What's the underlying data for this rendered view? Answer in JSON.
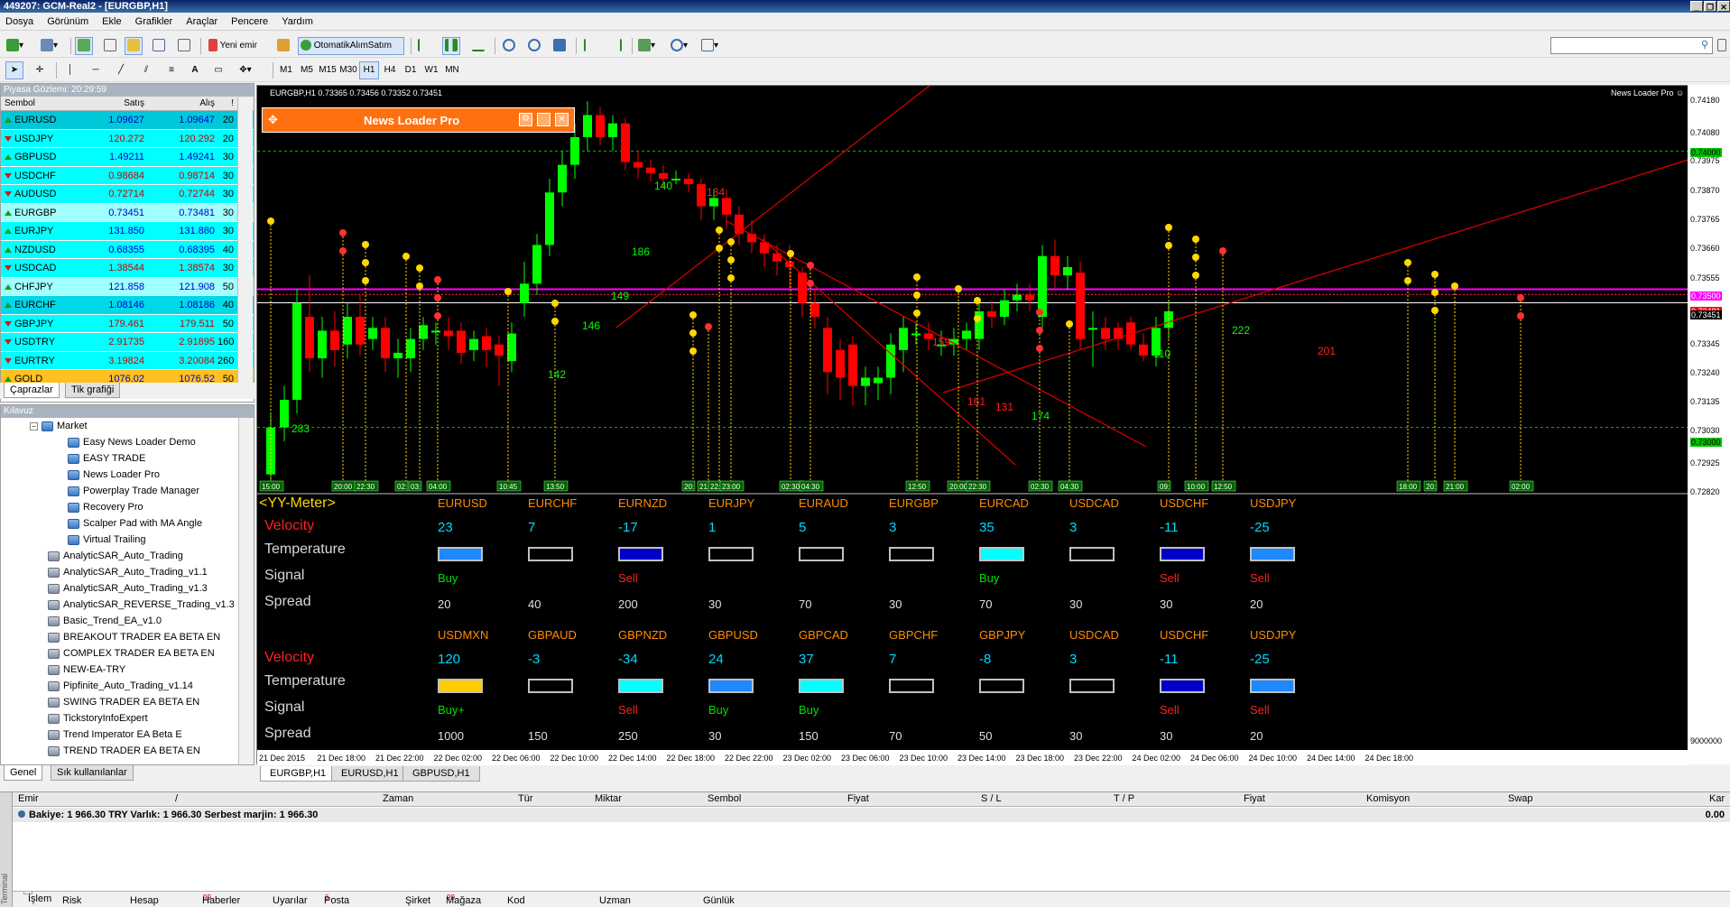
{
  "window": {
    "title": "449207: GCM-Real2 - [EURGBP,H1]",
    "min": "_",
    "restore": "❐",
    "close": "✕"
  },
  "menu": [
    "Dosya",
    "Görünüm",
    "Ekle",
    "Grafikler",
    "Araçlar",
    "Pencere",
    "Yardım"
  ],
  "toolbar": {
    "new_order": "Yeni emir",
    "autotrade": "OtomatikAlımSatım",
    "search_placeholder": ""
  },
  "timeframes": [
    "M1",
    "M5",
    "M15",
    "M30",
    "H1",
    "H4",
    "D1",
    "W1",
    "MN"
  ],
  "active_timeframe": "H1",
  "market_watch": {
    "title": "Piyasa Gözlemi: 20:29:59",
    "headers": [
      "Sembol",
      "Satış",
      "Alış",
      "!"
    ],
    "rows": [
      {
        "sym": "EURUSD",
        "bid": "1.09627",
        "ask": "1.09647",
        "spread": "20",
        "dir": "up",
        "bg": "#00c8d8"
      },
      {
        "sym": "USDJPY",
        "bid": "120.272",
        "ask": "120.292",
        "spread": "20",
        "dir": "dn",
        "bg": "#00ffff"
      },
      {
        "sym": "GBPUSD",
        "bid": "1.49211",
        "ask": "1.49241",
        "spread": "30",
        "dir": "up",
        "bg": "#00ffff"
      },
      {
        "sym": "USDCHF",
        "bid": "0.98684",
        "ask": "0.98714",
        "spread": "30",
        "dir": "dn",
        "bg": "#00ffff"
      },
      {
        "sym": "AUDUSD",
        "bid": "0.72714",
        "ask": "0.72744",
        "spread": "30",
        "dir": "dn",
        "bg": "#00ffff"
      },
      {
        "sym": "EURGBP",
        "bid": "0.73451",
        "ask": "0.73481",
        "spread": "30",
        "dir": "up",
        "bg": "#a0ffff"
      },
      {
        "sym": "EURJPY",
        "bid": "131.850",
        "ask": "131.880",
        "spread": "30",
        "dir": "up",
        "bg": "#00ffff"
      },
      {
        "sym": "NZDUSD",
        "bid": "0.68355",
        "ask": "0.68395",
        "spread": "40",
        "dir": "up",
        "bg": "#00ffff"
      },
      {
        "sym": "USDCAD",
        "bid": "1.38544",
        "ask": "1.38574",
        "spread": "30",
        "dir": "dn",
        "bg": "#00ffff"
      },
      {
        "sym": "CHFJPY",
        "bid": "121.858",
        "ask": "121.908",
        "spread": "50",
        "dir": "up",
        "bg": "#a0ffff"
      },
      {
        "sym": "EURCHF",
        "bid": "1.08146",
        "ask": "1.08186",
        "spread": "40",
        "dir": "up",
        "bg": "#00d8e8"
      },
      {
        "sym": "GBPJPY",
        "bid": "179.461",
        "ask": "179.511",
        "spread": "50",
        "dir": "dn",
        "bg": "#00ffff"
      },
      {
        "sym": "USDTRY",
        "bid": "2.91735",
        "ask": "2.91895",
        "spread": "160",
        "dir": "dn",
        "bg": "#00ffff"
      },
      {
        "sym": "EURTRY",
        "bid": "3.19824",
        "ask": "3.20084",
        "spread": "260",
        "dir": "dn",
        "bg": "#00ffff"
      },
      {
        "sym": "GOLD",
        "bid": "1076.02",
        "ask": "1076.52",
        "spread": "50",
        "dir": "up",
        "bg": "#ffc020"
      }
    ],
    "tabs": [
      "Çaprazlar",
      "Tik grafiği"
    ]
  },
  "navigator": {
    "title": "Kılavuz",
    "folder": "Market",
    "market_items": [
      "Easy News Loader Demo",
      "EASY TRADE",
      "News Loader Pro",
      "Powerplay Trade Manager",
      "Recovery Pro",
      "Scalper Pad with MA Angle",
      "Virtual Trailing"
    ],
    "experts": [
      "AnalyticSAR_Auto_Trading",
      "AnalyticSAR_Auto_Trading_v1.1",
      "AnalyticSAR_Auto_Trading_v1.3",
      "AnalyticSAR_REVERSE_Trading_v1.3",
      "Basic_Trend_EA_v1.0",
      "BREAKOUT TRADER EA BETA EN",
      "COMPLEX TRADER EA BETA EN",
      "NEW-EA-TRY",
      "Pipfinite_Auto_Trading_v1.14",
      "SWING TRADER EA BETA EN",
      "TickstoryInfoExpert",
      "Trend Imperator EA Beta E",
      "TREND TRADER EA BETA EN"
    ],
    "tabs": [
      "Genel",
      "Sık kullanılanlar"
    ]
  },
  "chart": {
    "header": "EURGBP,H1  0.73365 0.73456 0.73352 0.73451",
    "ea_label": "News Loader Pro ☺",
    "panel_title": "News Loader Pro",
    "meter_title": "<YY-Meter>",
    "price_labels": [
      "0.74180",
      "0.74080",
      "0.74000",
      "0.73975",
      "0.73870",
      "0.73765",
      "0.73660",
      "0.73555",
      "0.73500",
      "0.73481",
      "0.73451",
      "0.73345",
      "0.73240",
      "0.73135",
      "0.73030",
      "0.73000",
      "0.72925",
      "0.72820"
    ],
    "sub_label": "9000000",
    "time_labels": [
      "21 Dec 2015",
      "21 Dec 18:00",
      "21 Dec 22:00",
      "22 Dec 02:00",
      "22 Dec 06:00",
      "22 Dec 10:00",
      "22 Dec 14:00",
      "22 Dec 18:00",
      "22 Dec 22:00",
      "23 Dec 02:00",
      "23 Dec 06:00",
      "23 Dec 10:00",
      "23 Dec 14:00",
      "23 Dec 18:00",
      "23 Dec 22:00",
      "24 Dec 02:00",
      "24 Dec 06:00",
      "24 Dec 10:00",
      "24 Dec 14:00",
      "24 Dec 18:00"
    ],
    "event_times": [
      "15:00",
      "20:00",
      "22:30",
      "02:",
      "03:",
      "04:00",
      "10:45",
      "13:50",
      "20:",
      "21:",
      "22:",
      "23:00",
      "02:30",
      "04:30",
      "12:50",
      "20:00",
      "22:30",
      "02:30",
      "04:30",
      "09:",
      "10:00",
      "12:50",
      "18:00",
      "20:",
      "21:00",
      "02:00"
    ],
    "pip_labels": [
      {
        "t": "283",
        "c": "green"
      },
      {
        "t": "142",
        "c": "green"
      },
      {
        "t": "146",
        "c": "green"
      },
      {
        "t": "149",
        "c": "green"
      },
      {
        "t": "186",
        "c": "green"
      },
      {
        "t": "140",
        "c": "green"
      },
      {
        "t": "134",
        "c": "red"
      },
      {
        "t": "159",
        "c": "red"
      },
      {
        "t": "161",
        "c": "red"
      },
      {
        "t": "131",
        "c": "red"
      },
      {
        "t": "174",
        "c": "green"
      },
      {
        "t": "110",
        "c": "green"
      },
      {
        "t": "222",
        "c": "green"
      },
      {
        "t": "201",
        "c": "red"
      }
    ]
  },
  "meter": {
    "row_labels": [
      "Velocity",
      "Temperature",
      "Signal",
      "Spread"
    ],
    "block1": [
      {
        "pair": "EURUSD",
        "vel": "23",
        "temp": "#1e88ff",
        "sig": "Buy",
        "spread": "20"
      },
      {
        "pair": "EURCHF",
        "vel": "7",
        "temp": "#000000",
        "sig": "",
        "spread": "40"
      },
      {
        "pair": "EURNZD",
        "vel": "-17",
        "temp": "#0000c8",
        "sig": "Sell",
        "spread": "200"
      },
      {
        "pair": "EURJPY",
        "vel": "1",
        "temp": "#000000",
        "sig": "",
        "spread": "30"
      },
      {
        "pair": "EURAUD",
        "vel": "5",
        "temp": "#000000",
        "sig": "",
        "spread": "70"
      },
      {
        "pair": "EURGBP",
        "vel": "3",
        "temp": "#000000",
        "sig": "",
        "spread": "30"
      },
      {
        "pair": "EURCAD",
        "vel": "35",
        "temp": "#00ffff",
        "sig": "Buy",
        "spread": "70"
      },
      {
        "pair": "USDCAD",
        "vel": "3",
        "temp": "#000000",
        "sig": "",
        "spread": "30"
      },
      {
        "pair": "USDCHF",
        "vel": "-11",
        "temp": "#0000c8",
        "sig": "Sell",
        "spread": "30"
      },
      {
        "pair": "USDJPY",
        "vel": "-25",
        "temp": "#1e88ff",
        "sig": "Sell",
        "spread": "20"
      }
    ],
    "block2": [
      {
        "pair": "USDMXN",
        "vel": "120",
        "temp": "#ffcc00",
        "sig": "Buy+",
        "spread": "1000"
      },
      {
        "pair": "GBPAUD",
        "vel": "-3",
        "temp": "#000000",
        "sig": "",
        "spread": "150"
      },
      {
        "pair": "GBPNZD",
        "vel": "-34",
        "temp": "#00ffff",
        "sig": "Sell",
        "spread": "250"
      },
      {
        "pair": "GBPUSD",
        "vel": "24",
        "temp": "#1e88ff",
        "sig": "Buy",
        "spread": "30"
      },
      {
        "pair": "GBPCAD",
        "vel": "37",
        "temp": "#00ffff",
        "sig": "Buy",
        "spread": "150"
      },
      {
        "pair": "GBPCHF",
        "vel": "7",
        "temp": "#000000",
        "sig": "",
        "spread": "70"
      },
      {
        "pair": "GBPJPY",
        "vel": "-8",
        "temp": "#000000",
        "sig": "",
        "spread": "50"
      },
      {
        "pair": "USDCAD",
        "vel": "3",
        "temp": "#000000",
        "sig": "",
        "spread": "30"
      },
      {
        "pair": "USDCHF",
        "vel": "-11",
        "temp": "#0000c8",
        "sig": "Sell",
        "spread": "30"
      },
      {
        "pair": "USDJPY",
        "vel": "-25",
        "temp": "#1e88ff",
        "sig": "Sell",
        "spread": "20"
      }
    ]
  },
  "chart_tabs": [
    "EURGBP,H1",
    "EURUSD,H1",
    "GBPUSD,H1"
  ],
  "terminal": {
    "side": "Terminal",
    "headers": [
      "Emir",
      "/",
      "Zaman",
      "Tür",
      "Miktar",
      "Sembol",
      "Fiyat",
      "S / L",
      "T / P",
      "Fiyat",
      "Komisyon",
      "Swap",
      "Kar"
    ],
    "balance": "Bakiye: 1 966.30 TRY  Varlık: 1 966.30  Serbest marjin: 1 966.30",
    "profit": "0.00",
    "tabs": [
      "İşlem",
      "Risk Analizi",
      "Hesap geçmişi",
      "Haberler",
      "Uyarılar",
      "Posta kutusu",
      "Şirket",
      "Mağaza",
      "Kod Kütüphanesi",
      "Uzman danışmanlar",
      "Günlük"
    ],
    "badges": {
      "Haberler": "99",
      "Posta kutusu": "6",
      "Mağaza": "99"
    }
  },
  "colors": {
    "bull": "#00ff00",
    "bear": "#ff0000",
    "bg": "#000000",
    "accent": "#ff7010"
  }
}
